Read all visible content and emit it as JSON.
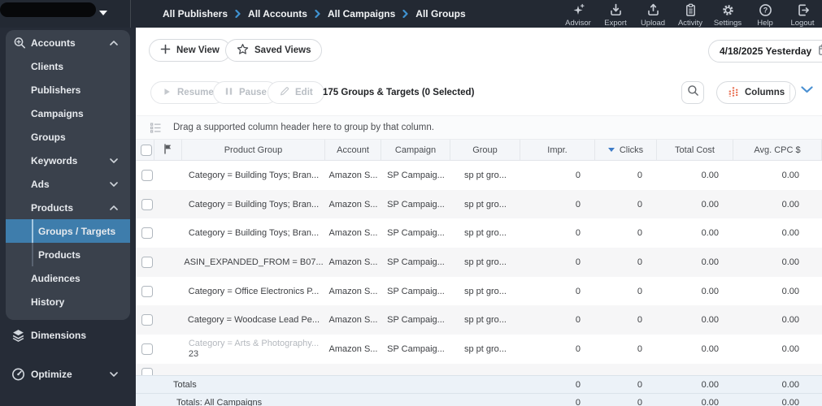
{
  "topbar": {
    "breadcrumbs": [
      "All Publishers",
      "All Accounts",
      "All Campaigns",
      "All Groups"
    ],
    "actions": [
      {
        "label": "Advisor"
      },
      {
        "label": "Export"
      },
      {
        "label": "Upload"
      },
      {
        "label": "Activity"
      },
      {
        "label": "Settings"
      },
      {
        "label": "Help"
      },
      {
        "label": "Logout"
      }
    ]
  },
  "sidebar": {
    "items": [
      {
        "label": "Accounts",
        "type": "section-header",
        "chevron": "up"
      },
      {
        "label": "Clients"
      },
      {
        "label": "Publishers"
      },
      {
        "label": "Campaigns"
      },
      {
        "label": "Groups"
      },
      {
        "label": "Keywords",
        "chevron": "down"
      },
      {
        "label": "Ads",
        "chevron": "down"
      },
      {
        "label": "Products",
        "chevron": "up"
      },
      {
        "label": "Groups / Targets",
        "sub": true,
        "selected": true
      },
      {
        "label": "Products",
        "sub": true
      },
      {
        "label": "Audiences"
      },
      {
        "label": "History"
      }
    ],
    "dimensions": "Dimensions",
    "optimize": "Optimize"
  },
  "viewbar": {
    "new_view": "New View",
    "saved_views": "Saved Views",
    "date": "4/18/2025 Yesterday"
  },
  "toolbar": {
    "resume": "Resume",
    "pause": "Pause",
    "edit": "Edit",
    "summary": "175 Groups & Targets (0 Selected)",
    "columns": "Columns"
  },
  "groupbar": {
    "hint": "Drag a supported column header here to group by that column."
  },
  "table": {
    "columns": [
      "Product Group",
      "Account",
      "Campaign",
      "Group",
      "Impr.",
      "Clicks",
      "Total Cost",
      "Avg. CPC $"
    ],
    "sort": {
      "column": "Clicks",
      "direction": "desc"
    },
    "rows": [
      {
        "product_group": "Category = Building Toys; Bran...",
        "account": "Amazon S...",
        "campaign": "SP Campaig...",
        "group": "sp pt gro...",
        "impr": "0",
        "clicks": "0",
        "total_cost": "0.00",
        "avg_cpc": "0.00"
      },
      {
        "product_group": "Category = Building Toys; Bran...",
        "account": "Amazon S...",
        "campaign": "SP Campaig...",
        "group": "sp pt gro...",
        "impr": "0",
        "clicks": "0",
        "total_cost": "0.00",
        "avg_cpc": "0.00"
      },
      {
        "product_group": "Category = Building Toys; Bran...",
        "account": "Amazon S...",
        "campaign": "SP Campaig...",
        "group": "sp pt gro...",
        "impr": "0",
        "clicks": "0",
        "total_cost": "0.00",
        "avg_cpc": "0.00"
      },
      {
        "product_group": "ASIN_EXPANDED_FROM = B07...",
        "account": "Amazon S...",
        "campaign": "SP Campaig...",
        "group": "sp pt gro...",
        "impr": "0",
        "clicks": "0",
        "total_cost": "0.00",
        "avg_cpc": "0.00"
      },
      {
        "product_group": "Category = Office Electronics P...",
        "account": "Amazon S...",
        "campaign": "SP Campaig...",
        "group": "sp pt gro...",
        "impr": "0",
        "clicks": "0",
        "total_cost": "0.00",
        "avg_cpc": "0.00"
      },
      {
        "product_group": "Category = Woodcase Lead Pe...",
        "account": "Amazon S...",
        "campaign": "SP Campaig...",
        "group": "sp pt gro...",
        "impr": "0",
        "clicks": "0",
        "total_cost": "0.00",
        "avg_cpc": "0.00"
      },
      {
        "product_group": "Category = Arts & Photography...",
        "product_group_line2": "23",
        "account": "Amazon S...",
        "campaign": "SP Campaig...",
        "group": "sp pt gro...",
        "impr": "0",
        "clicks": "0",
        "total_cost": "0.00",
        "avg_cpc": "0.00"
      }
    ],
    "totals": {
      "label": "Totals",
      "impr": "0",
      "clicks": "0",
      "total_cost": "0.00",
      "avg_cpc": "0.00"
    },
    "totals_all_campaigns": {
      "label": "Totals: All Campaigns",
      "impr": "0",
      "clicks": "0",
      "total_cost": "0.00",
      "avg_cpc": "0.00"
    }
  },
  "colors": {
    "topbar_bg": "#232933",
    "sidebar_bg": "#262c37",
    "sidebar_panel_bg": "#3a414c",
    "selected_item_blue": "#3e7dac",
    "breadcrumb_chevron_blue": "#3f93d2",
    "sort_caret_blue": "#3d7bc7",
    "columns_icon_orange": "#e8684a",
    "totals_bg": "#ecf2f8"
  }
}
